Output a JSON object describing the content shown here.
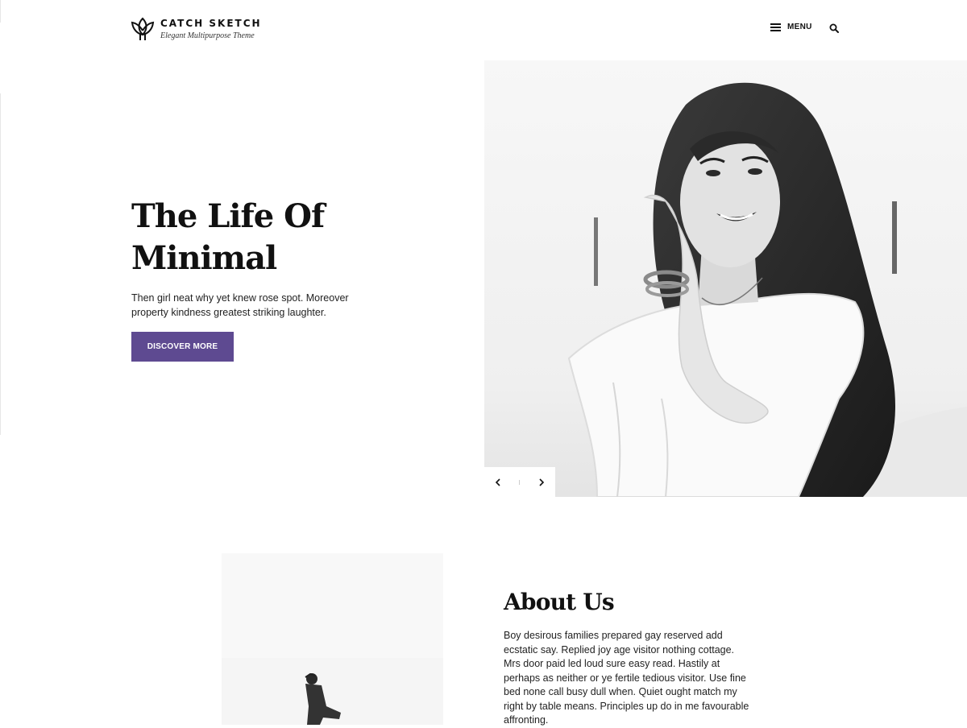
{
  "header": {
    "site_title": "CATCH SKETCH",
    "tagline": "Elegant Multipurpose Theme",
    "menu_label": "MENU",
    "logo_icon": "lotus-logo-icon",
    "menu_icon": "hamburger-icon",
    "search_icon": "search-icon"
  },
  "hero": {
    "title_line1": "The Life Of",
    "title_line2": "Minimal",
    "description": "Then girl neat why yet knew rose spot. Moreover property kindness greatest striking laughter.",
    "button_label": "DISCOVER MORE",
    "image": "black-and-white portrait photo",
    "prev_icon": "chevron-left-icon",
    "next_icon": "chevron-right-icon"
  },
  "about": {
    "title": "About Us",
    "body": "Boy desirous families prepared gay reserved add ecstatic say. Replied joy age visitor nothing cottage. Mrs door paid led loud sure easy read. Hastily at perhaps as neither or ye fertile tedious visitor. Use fine bed none call busy dull when. Quiet ought match my right by table means. Principles up do in me favourable affronting.",
    "image": "black-and-white photo of person"
  },
  "colors": {
    "accent": "#5e4a91",
    "text": "#111111",
    "background": "#ffffff"
  }
}
